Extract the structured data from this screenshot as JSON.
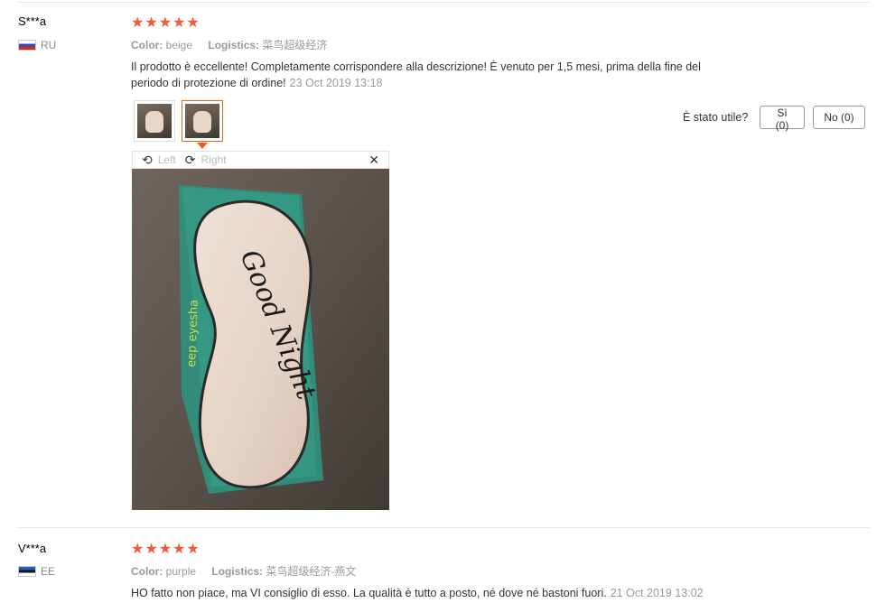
{
  "reviews": [
    {
      "user": "S***a",
      "country": "RU",
      "rating": 5,
      "color_label": "Color:",
      "color_value": "beige",
      "logistics_label": "Logistics:",
      "logistics_value": "菜鸟超级经济",
      "text_line1": "Il prodotto è eccellente! Completamente corrispondere alla descrizione! È venuto per 1,5 mesi, prima della fine del",
      "text_line2": "periodo di protezione di ordine!",
      "date": "23 Oct 2019 13:18",
      "photo_viewer": {
        "left_label": "Left",
        "right_label": "Right",
        "close_icon": "close-icon",
        "photo_text": "Good Night",
        "package_text": "eep eyesha"
      }
    },
    {
      "user": "V***a",
      "country": "EE",
      "rating": 5,
      "color_label": "Color:",
      "color_value": "purple",
      "logistics_label": "Logistics:",
      "logistics_value": "菜鸟超级经济-燕文",
      "text_line1": "HO fatto non piace, ma VI consiglio di esso. La qualità è tutto a posto, né dove né bastoni fuori.",
      "date": "21 Oct 2019 13:02"
    }
  ],
  "helpful": {
    "label": "È stato utile?",
    "yes_label": "Sì (0)",
    "no_label": "No (0)"
  },
  "stars_text": "★★★★★",
  "colors": {
    "star": "#f15a3c",
    "active_thumb": "#e85f1e"
  }
}
